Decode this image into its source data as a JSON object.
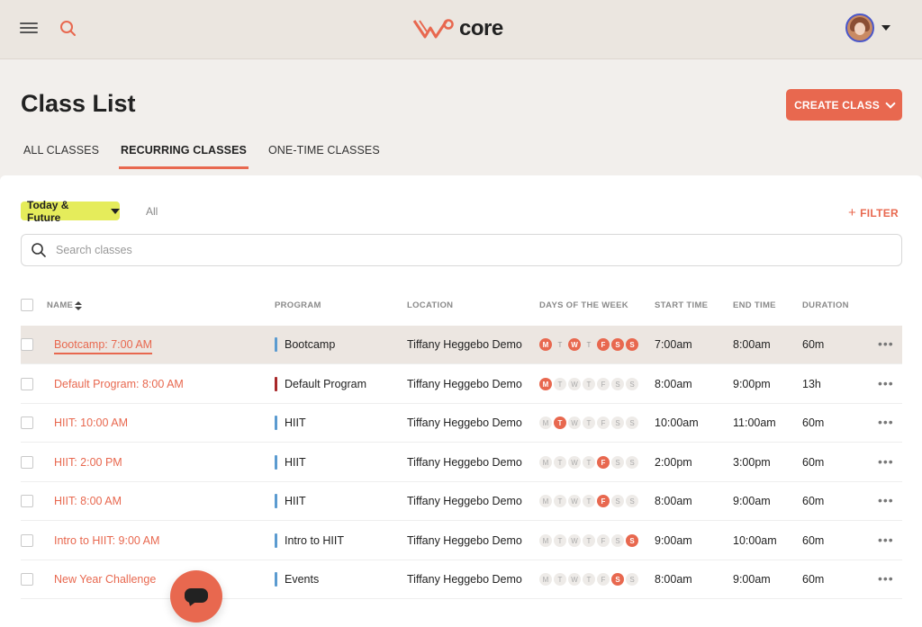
{
  "header": {
    "logo_text": "core",
    "brand_color": "#e8684f"
  },
  "page": {
    "title": "Class List",
    "create_button": "CREATE CLASS"
  },
  "tabs": [
    {
      "label": "ALL CLASSES",
      "active": false
    },
    {
      "label": "RECURRING CLASSES",
      "active": true
    },
    {
      "label": "ONE-TIME CLASSES",
      "active": false
    }
  ],
  "filters": {
    "time_filter": "Today & Future",
    "all_label": "All",
    "filter_button": "FILTER",
    "search_placeholder": "Search classes"
  },
  "table": {
    "columns": [
      "NAME",
      "PROGRAM",
      "LOCATION",
      "DAYS OF THE WEEK",
      "START TIME",
      "END TIME",
      "DURATION"
    ],
    "day_letters": [
      "M",
      "T",
      "W",
      "T",
      "F",
      "S",
      "S"
    ],
    "rows": [
      {
        "name": "Bootcamp: 7:00 AM",
        "program": "Bootcamp",
        "program_color": "#5b9bd0",
        "location": "Tiffany Heggebo Demo",
        "days": [
          1,
          0,
          1,
          0,
          1,
          1,
          1
        ],
        "start": "7:00am",
        "end": "8:00am",
        "duration": "60m"
      },
      {
        "name": "Default Program: 8:00 AM",
        "program": "Default Program",
        "program_color": "#a8282a",
        "location": "Tiffany Heggebo Demo",
        "days": [
          1,
          0,
          0,
          0,
          0,
          0,
          0
        ],
        "start": "8:00am",
        "end": "9:00pm",
        "duration": "13h"
      },
      {
        "name": "HIIT: 10:00 AM",
        "program": "HIIT",
        "program_color": "#5b9bd0",
        "location": "Tiffany Heggebo Demo",
        "days": [
          0,
          1,
          0,
          0,
          0,
          0,
          0
        ],
        "start": "10:00am",
        "end": "11:00am",
        "duration": "60m"
      },
      {
        "name": "HIIT: 2:00 PM",
        "program": "HIIT",
        "program_color": "#5b9bd0",
        "location": "Tiffany Heggebo Demo",
        "days": [
          0,
          0,
          0,
          0,
          1,
          0,
          0
        ],
        "start": "2:00pm",
        "end": "3:00pm",
        "duration": "60m"
      },
      {
        "name": "HIIT: 8:00 AM",
        "program": "HIIT",
        "program_color": "#5b9bd0",
        "location": "Tiffany Heggebo Demo",
        "days": [
          0,
          0,
          0,
          0,
          1,
          0,
          0
        ],
        "start": "8:00am",
        "end": "9:00am",
        "duration": "60m"
      },
      {
        "name": "Intro to HIIT: 9:00 AM",
        "program": "Intro to HIIT",
        "program_color": "#5b9bd0",
        "location": "Tiffany Heggebo Demo",
        "days": [
          0,
          0,
          0,
          0,
          0,
          0,
          1
        ],
        "start": "9:00am",
        "end": "10:00am",
        "duration": "60m"
      },
      {
        "name": "New Year Challenge",
        "program": "Events",
        "program_color": "#5b9bd0",
        "location": "Tiffany Heggebo Demo",
        "days": [
          0,
          0,
          0,
          0,
          0,
          1,
          0
        ],
        "start": "8:00am",
        "end": "9:00am",
        "duration": "60m"
      }
    ]
  },
  "more_glyph": "•••"
}
